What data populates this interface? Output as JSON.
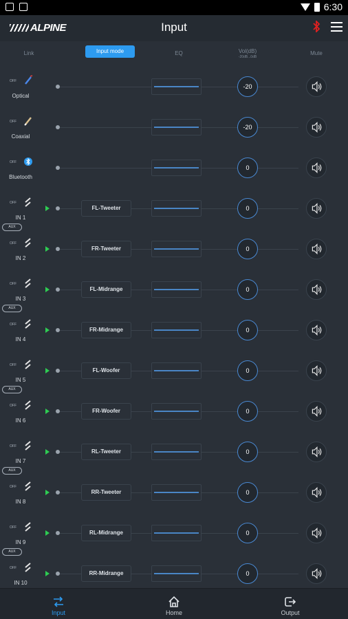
{
  "status": {
    "time": "6:30"
  },
  "header": {
    "logo": "ALPINE",
    "title": "Input"
  },
  "columns": {
    "link": "Link",
    "input_mode": "Input mode",
    "eq": "EQ",
    "vol": "Vol(dB)",
    "vol_range": "-20dB...0dB",
    "mute": "Mute"
  },
  "link_label": "OFF",
  "rows": [
    {
      "label": "Optical",
      "icon": "optical-icon",
      "mode": "",
      "vol": "-20",
      "play": false
    },
    {
      "label": "Coaxial",
      "icon": "coaxial-icon",
      "mode": "",
      "vol": "-20",
      "play": false
    },
    {
      "label": "Bluetooth",
      "icon": "bluetooth-icon",
      "mode": "",
      "vol": "0",
      "play": false
    },
    {
      "label": "IN 1",
      "icon": "rca-icon",
      "mode": "FL-Tweeter",
      "vol": "0",
      "play": true
    },
    {
      "label": "IN 2",
      "icon": "rca-icon",
      "mode": "FR-Tweeter",
      "vol": "0",
      "play": true
    },
    {
      "label": "IN 3",
      "icon": "rca-icon",
      "mode": "FL-Midrange",
      "vol": "0",
      "play": true
    },
    {
      "label": "IN 4",
      "icon": "rca-icon",
      "mode": "FR-Midrange",
      "vol": "0",
      "play": true
    },
    {
      "label": "IN 5",
      "icon": "rca-icon",
      "mode": "FL-Woofer",
      "vol": "0",
      "play": true
    },
    {
      "label": "IN 6",
      "icon": "rca-icon",
      "mode": "FR-Woofer",
      "vol": "0",
      "play": true
    },
    {
      "label": "IN 7",
      "icon": "rca-icon",
      "mode": "RL-Tweeter",
      "vol": "0",
      "play": true
    },
    {
      "label": "IN 8",
      "icon": "rca-icon",
      "mode": "RR-Tweeter",
      "vol": "0",
      "play": true
    },
    {
      "label": "IN 9",
      "icon": "rca-icon",
      "mode": "RL-Midrange",
      "vol": "0",
      "play": true
    },
    {
      "label": "IN 10",
      "icon": "rca-icon",
      "mode": "RR-Midrange",
      "vol": "0",
      "play": true
    }
  ],
  "aux_label": "AUX",
  "nav": {
    "input": "Input",
    "home": "Home",
    "output": "Output"
  },
  "colors": {
    "accent": "#2d9bf0",
    "play": "#2ecc52",
    "bluetooth_alert": "#e02020"
  }
}
